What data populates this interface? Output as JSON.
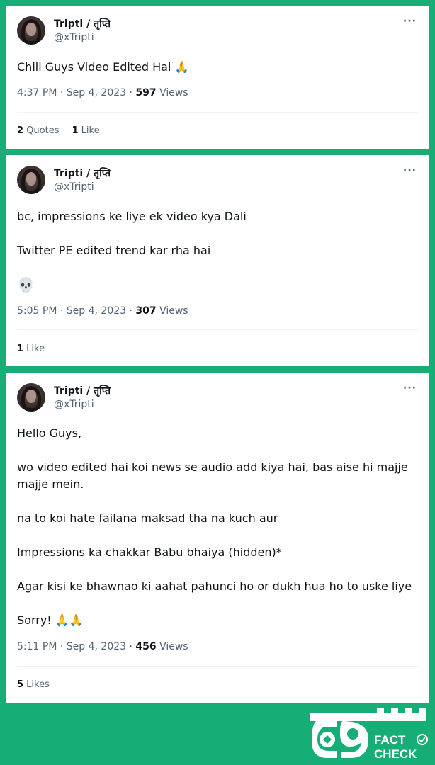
{
  "tweets": [
    {
      "name": "Tripti / तृप्ति",
      "handle": "@xTripti",
      "more": "···",
      "lines": [
        "Chill Guys Video Edited Hai 🙏"
      ],
      "time": "4:37 PM · Sep 4, 2023 · ",
      "views_count": "597",
      "views_label": " Views",
      "stats": [
        {
          "count": "2",
          "label": " Quotes"
        },
        {
          "count": "1",
          "label": " Like"
        }
      ]
    },
    {
      "name": "Tripti / तृप्ति",
      "handle": "@xTripti",
      "more": "···",
      "lines": [
        "bc, impressions ke liye ek video kya Dali",
        "Twitter PE edited trend kar rha hai",
        "💀"
      ],
      "time": "5:05 PM · Sep 4, 2023 · ",
      "views_count": "307",
      "views_label": " Views",
      "stats": [
        {
          "count": "1",
          "label": " Like"
        }
      ]
    },
    {
      "name": "Tripti / तृप्ति",
      "handle": "@xTripti",
      "more": "···",
      "lines": [
        "Hello Guys,",
        "wo video edited hai koi news se audio add kiya hai, bas aise hi majje majje mein.",
        "na to koi hate failana maksad tha na kuch aur",
        "Impressions ka chakkar Babu bhaiya (hidden)*",
        "Agar kisi ke bhawnao ki aahat pahunci ho or dukh hua ho to uske liye",
        "Sorry! 🙏🙏"
      ],
      "time": "5:11 PM · Sep 4, 2023 · ",
      "views_count": "456",
      "views_label": " Views",
      "stats": [
        {
          "count": "5",
          "label": " Likes"
        }
      ]
    }
  ],
  "watermark": {
    "word1": "FACT",
    "word2": "CHECK",
    "brand_color": "#17ad76"
  }
}
